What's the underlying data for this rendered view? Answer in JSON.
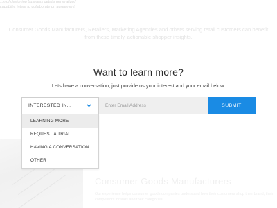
{
  "background": {
    "top_snippet": "...n of designing business details generalized capabilty, intent to collaborate on agreement",
    "intro": "Consumer Goods Manufacturers, Retailers, Marketing Agencies and others serving retail customers can benefit from these timely, actionable shopper insights.",
    "section_heading": "Consumer Goods Manufacturers",
    "section_body": "Our experience helps consumer goods companies understand how their customers shop their brand, their competitors' brands and their categories."
  },
  "form": {
    "title": "Want to learn more?",
    "subtitle": "Lets have a conversation, just provide us your interest and your email below.",
    "interest_label": "INTERESTED IN...",
    "email_placeholder": "Enter Email Address",
    "submit_label": "SUBMIT",
    "options": [
      {
        "label": "LEARNING MORE",
        "highlighted": true
      },
      {
        "label": "REQUEST A TRIAL",
        "highlighted": false
      },
      {
        "label": "HAVING A CONVERSATION",
        "highlighted": false
      },
      {
        "label": "OTHER",
        "highlighted": false
      }
    ]
  },
  "colors": {
    "accent": "#1a8be4",
    "chevron": "#1a8be4",
    "highlight": "#ececec"
  },
  "icons": {
    "select_chevron": "chevron-down-icon"
  }
}
